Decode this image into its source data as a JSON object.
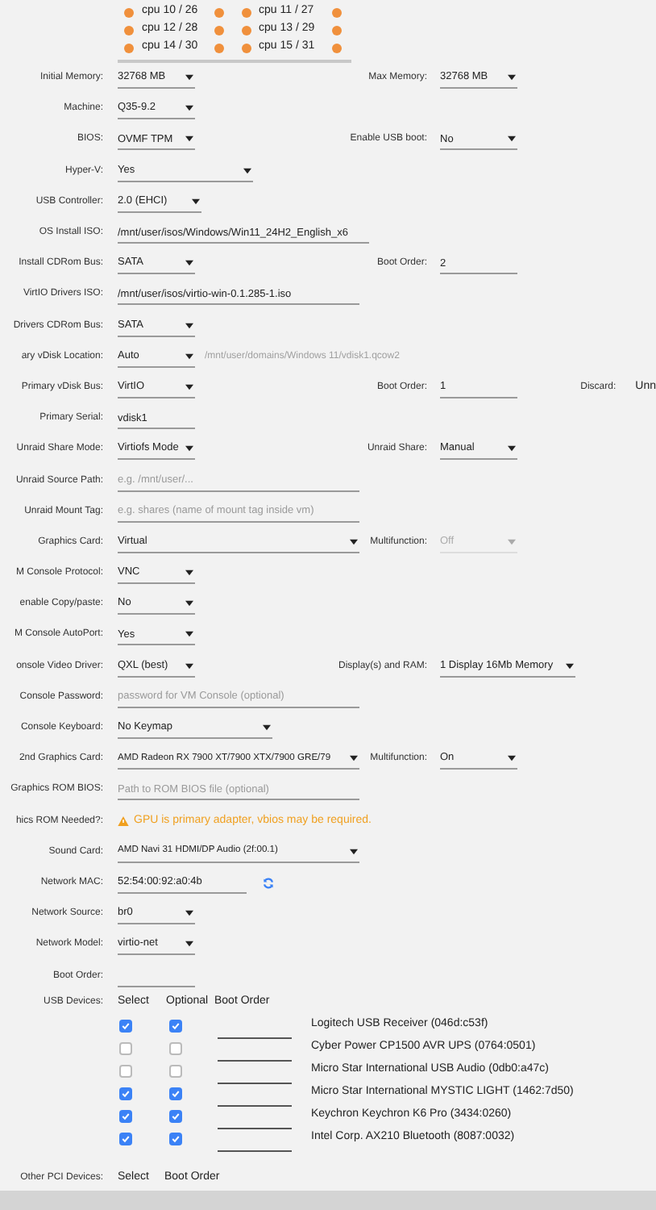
{
  "cpus": [
    {
      "label": "cpu 10 / 26",
      "pinned": true
    },
    {
      "label": "cpu 11 / 27",
      "pinned": true
    },
    {
      "label": "cpu 12 / 28",
      "pinned": true
    },
    {
      "label": "cpu 13 / 29",
      "pinned": true
    },
    {
      "label": "cpu 14 / 30",
      "pinned": true
    },
    {
      "label": "cpu 15 / 31",
      "pinned": true
    }
  ],
  "rows": [
    {
      "label": "Initial Memory:",
      "field": {
        "kind": "select",
        "value": "32768 MB"
      },
      "right": {
        "label": "Max Memory:",
        "field": {
          "kind": "select",
          "value": "32768 MB"
        }
      }
    },
    {
      "label": "Machine:",
      "field": {
        "kind": "select",
        "value": "Q35-9.2"
      }
    },
    {
      "label": "BIOS:",
      "field": {
        "kind": "select",
        "value": "OVMF TPM"
      },
      "right": {
        "label": "Enable USB boot:",
        "field": {
          "kind": "select",
          "value": "No"
        }
      }
    },
    {
      "label": "Hyper-V:",
      "field": {
        "kind": "select",
        "value": "Yes"
      }
    },
    {
      "label": "USB Controller:",
      "field": {
        "kind": "select",
        "value": "2.0 (EHCI)"
      }
    },
    {
      "label": "OS Install ISO:",
      "field": {
        "kind": "text",
        "value": "/mnt/user/isos/Windows/Win11_24H2_English_x6"
      }
    },
    {
      "label": "Install CDRom Bus:",
      "field": {
        "kind": "select",
        "value": "SATA"
      },
      "right": {
        "label": "Boot Order:",
        "field": {
          "kind": "text",
          "value": "2"
        }
      }
    },
    {
      "label": "VirtIO Drivers ISO:",
      "field": {
        "kind": "text",
        "value": "/mnt/user/isos/virtio-win-0.1.285-1.iso"
      }
    },
    {
      "label": "Drivers CDRom Bus:",
      "field": {
        "kind": "select",
        "value": "SATA"
      }
    },
    {
      "label": "ary vDisk Location:",
      "field": {
        "kind": "select",
        "value": "Auto"
      },
      "note": "/mnt/user/domains/Windows 11/vdisk1.qcow2"
    },
    {
      "label": "Primary vDisk Bus:",
      "field": {
        "kind": "select",
        "value": "VirtIO"
      },
      "right": {
        "label": "Boot Order:",
        "field": {
          "kind": "text",
          "value": "1"
        }
      },
      "extra": {
        "label": "Discard:",
        "value": "Unn"
      }
    },
    {
      "label": "Primary Serial:",
      "field": {
        "kind": "text",
        "value": "vdisk1"
      }
    },
    {
      "label": "Unraid Share Mode:",
      "field": {
        "kind": "select",
        "value": "Virtiofs Mode"
      },
      "right": {
        "label": "Unraid Share:",
        "field": {
          "kind": "select",
          "value": "Manual"
        }
      }
    },
    {
      "label": "Unraid Source Path:",
      "field": {
        "kind": "text",
        "placeholder": "e.g. /mnt/user/..."
      }
    },
    {
      "label": "Unraid Mount Tag:",
      "field": {
        "kind": "text",
        "placeholder": "e.g. shares (name of mount tag inside vm)"
      }
    },
    {
      "label": "Graphics Card:",
      "field": {
        "kind": "select",
        "value": "Virtual"
      },
      "right": {
        "label": "Multifunction:",
        "field": {
          "kind": "select",
          "value": "Off",
          "disabled": true
        }
      }
    },
    {
      "label": "M Console Protocol:",
      "field": {
        "kind": "select",
        "value": "VNC"
      }
    },
    {
      "label": "enable Copy/paste:",
      "field": {
        "kind": "select",
        "value": "No"
      }
    },
    {
      "label": "M Console AutoPort:",
      "field": {
        "kind": "select",
        "value": "Yes"
      }
    },
    {
      "label": "onsole Video Driver:",
      "field": {
        "kind": "select",
        "value": "QXL (best)"
      },
      "right": {
        "label": "Display(s) and RAM:",
        "field": {
          "kind": "select",
          "value": "1 Display 16Mb Memory"
        }
      }
    },
    {
      "label": "Console Password:",
      "field": {
        "kind": "text",
        "placeholder": "password for VM Console (optional)"
      }
    },
    {
      "label": "Console Keyboard:",
      "field": {
        "kind": "select",
        "value": "No Keymap"
      }
    },
    {
      "label": "2nd Graphics Card:",
      "field": {
        "kind": "select",
        "value": "AMD Radeon RX 7900 XT/7900 XTX/7900 GRE/79"
      },
      "right": {
        "label": "Multifunction:",
        "field": {
          "kind": "select",
          "value": "On",
          "disabled": false
        }
      }
    },
    {
      "label": "Graphics ROM BIOS:",
      "field": {
        "kind": "text",
        "placeholder": "Path to ROM BIOS file (optional)"
      }
    },
    {
      "label": "hics ROM Needed?:",
      "field": {
        "kind": "warning",
        "value": "GPU is primary adapter, vbios may be required."
      }
    },
    {
      "label": "Sound Card:",
      "field": {
        "kind": "select",
        "value": "AMD Navi 31 HDMI/DP Audio (2f:00.1)"
      }
    },
    {
      "label": "Network MAC:",
      "field": {
        "kind": "mac",
        "value": "52:54:00:92:a0:4b"
      }
    },
    {
      "label": "Network Source:",
      "field": {
        "kind": "select",
        "value": "br0"
      }
    },
    {
      "label": "Network Model:",
      "field": {
        "kind": "select",
        "value": "virtio-net"
      }
    },
    {
      "label": "Boot Order:",
      "field": {
        "kind": "text"
      }
    }
  ],
  "usb": {
    "label": "USB Devices:",
    "headers": [
      "Select",
      "Optional",
      "Boot Order"
    ],
    "devices": [
      {
        "name": "Logitech USB Receiver (046d:c53f)",
        "checked": true,
        "optional": true
      },
      {
        "name": "Cyber Power CP1500 AVR UPS (0764:0501)",
        "checked": false,
        "optional": false
      },
      {
        "name": "Micro Star International USB Audio (0db0:a47c)",
        "checked": false,
        "optional": false
      },
      {
        "name": "Micro Star International MYSTIC LIGHT (1462:7d50)",
        "checked": true,
        "optional": true
      },
      {
        "name": "Keychron Keychron K6 Pro (3434:0260)",
        "checked": true,
        "optional": true
      },
      {
        "name": "Intel Corp. AX210 Bluetooth (8087:0032)",
        "checked": true,
        "optional": true
      }
    ]
  },
  "other_pci": {
    "label": "Other PCI Devices:",
    "headers": [
      "Select",
      "Boot Order"
    ]
  }
}
